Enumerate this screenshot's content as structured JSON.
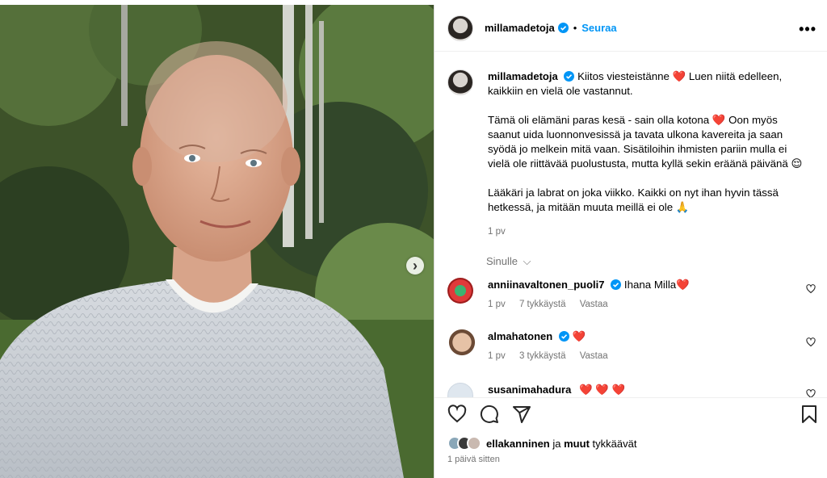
{
  "post": {
    "author": "millamadetoja",
    "follow_label": "Seuraa",
    "dot": "•",
    "more_glyph": "•••",
    "next_glyph": "›",
    "caption_author": "millamadetoja",
    "caption_p1": "Kiitos viesteistänne ❤️ Luen niitä edelleen, kaikkiin en vielä ole vastannut.",
    "caption_p2": "Tämä oli elämäni paras kesä - sain olla kotona ❤️ Oon myös saanut uida luonnonvesissä ja tavata ulkona kavereita ja saan syödä jo melkein mitä vaan. Sisätiloihin ihmisten pariin mulla ei vielä ole riittävää puolustusta, mutta kyllä sekin eräänä päivänä 😌",
    "caption_p3": "Lääkäri ja labrat on joka viikko. Kaikki on nyt ihan hyvin tässä hetkessä, ja mitään muuta meillä ei ole 🙏",
    "caption_time": "1 pv"
  },
  "filter": {
    "label": "Sinulle",
    "chevron": "⌵"
  },
  "comments": [
    {
      "user": "anniinavaltonen_puoli7",
      "text": "Ihana Milla❤️",
      "time": "1 pv",
      "likes": "7 tykkäystä",
      "reply": "Vastaa"
    },
    {
      "user": "almahatonen",
      "text": "❤️",
      "time": "1 pv",
      "likes": "3 tykkäystä",
      "reply": "Vastaa"
    },
    {
      "user": "susanimahadura",
      "text": "❤️ ❤️ ❤️"
    }
  ],
  "likes": {
    "user": "ellakanninen",
    "joiner": "ja",
    "rest": "muut",
    "suffix": "tykkäävät"
  },
  "posted": "1 päivä sitten",
  "colors": {
    "accent": "#0095f6",
    "heart": "#ed1c5a",
    "muted": "#737373",
    "border": "#dbdbdb"
  },
  "icons": [
    "verified-badge-icon",
    "more-options-icon",
    "next-image-icon",
    "heart-icon",
    "comment-icon",
    "share-icon",
    "bookmark-icon",
    "chevron-down-icon"
  ]
}
